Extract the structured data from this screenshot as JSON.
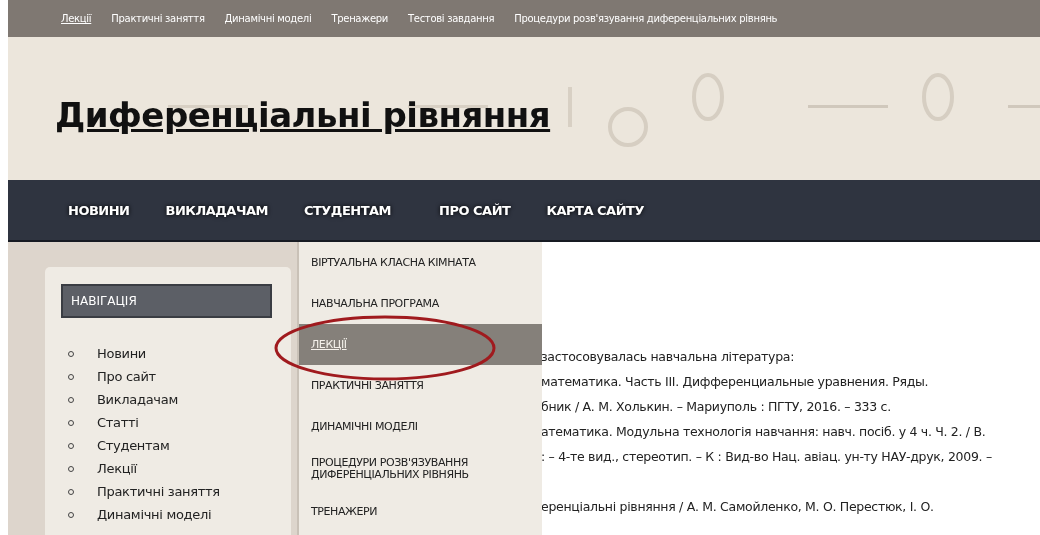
{
  "top_links": [
    {
      "label": "Лекції",
      "selected": true
    },
    {
      "label": "Практичні заняття",
      "selected": false
    },
    {
      "label": "Динамічні моделі",
      "selected": false
    },
    {
      "label": "Тренажери",
      "selected": false
    },
    {
      "label": "Тестові завдання",
      "selected": false
    },
    {
      "label": "Процедури розв'язування диференціальних рівнянь",
      "selected": false
    }
  ],
  "header": {
    "title": "Диференціальні рівняння"
  },
  "main_menu": [
    {
      "label": "НОВИНИ"
    },
    {
      "label": "ВИКЛАДАЧАМ"
    },
    {
      "label": "СТУДЕНТАМ"
    },
    {
      "label": "ПРО САЙТ"
    },
    {
      "label": "КАРТА САЙТУ"
    }
  ],
  "dropdown": [
    {
      "label": "ВІРТУАЛЬНА КЛАСНА КІМНАТА",
      "selected": false
    },
    {
      "label": "НАВЧАЛЬНА ПРОГРАМА",
      "selected": false
    },
    {
      "label": "ЛЕКЦІЇ",
      "selected": true
    },
    {
      "label": "ПРАКТИЧНІ ЗАНЯТТЯ",
      "selected": false
    },
    {
      "label": "ДИНАМІЧНІ МОДЕЛІ",
      "selected": false
    },
    {
      "label": "ПРОЦЕДУРИ РОЗВ'ЯЗУВАННЯ ДИФЕРЕНЦІАЛЬНИХ РІВНЯНЬ",
      "selected": false
    },
    {
      "label": "ТРЕНАЖЕРИ",
      "selected": false
    }
  ],
  "sidebar": {
    "title": "НАВІГАЦІЯ",
    "items": [
      "Новини",
      "Про сайт",
      "Викладачам",
      "Статті",
      "Студентам",
      "Лекції",
      "Практичні заняття",
      "Динамічні моделі"
    ]
  },
  "content": [
    [
      "застосовувалась навчальна література:",
      "математика. Часть III. Дифференциальные уравнения. Ряды.",
      "бник / А. М. Холькин. – Мариуполь : ПГТУ, 2016. – 333 с.",
      "атематика. Модульна технологія навчання: навч. посіб. у 4 ч. Ч. 2. / В.",
      ": – 4-те вид., стереотип. – К : Вид-во Нац. авіац. ун-ту НАУ-друк, 2009. –"
    ],
    [
      "еренціальні рівняння / А. М. Самойленко, М. О. Перестюк, І. О."
    ]
  ]
}
